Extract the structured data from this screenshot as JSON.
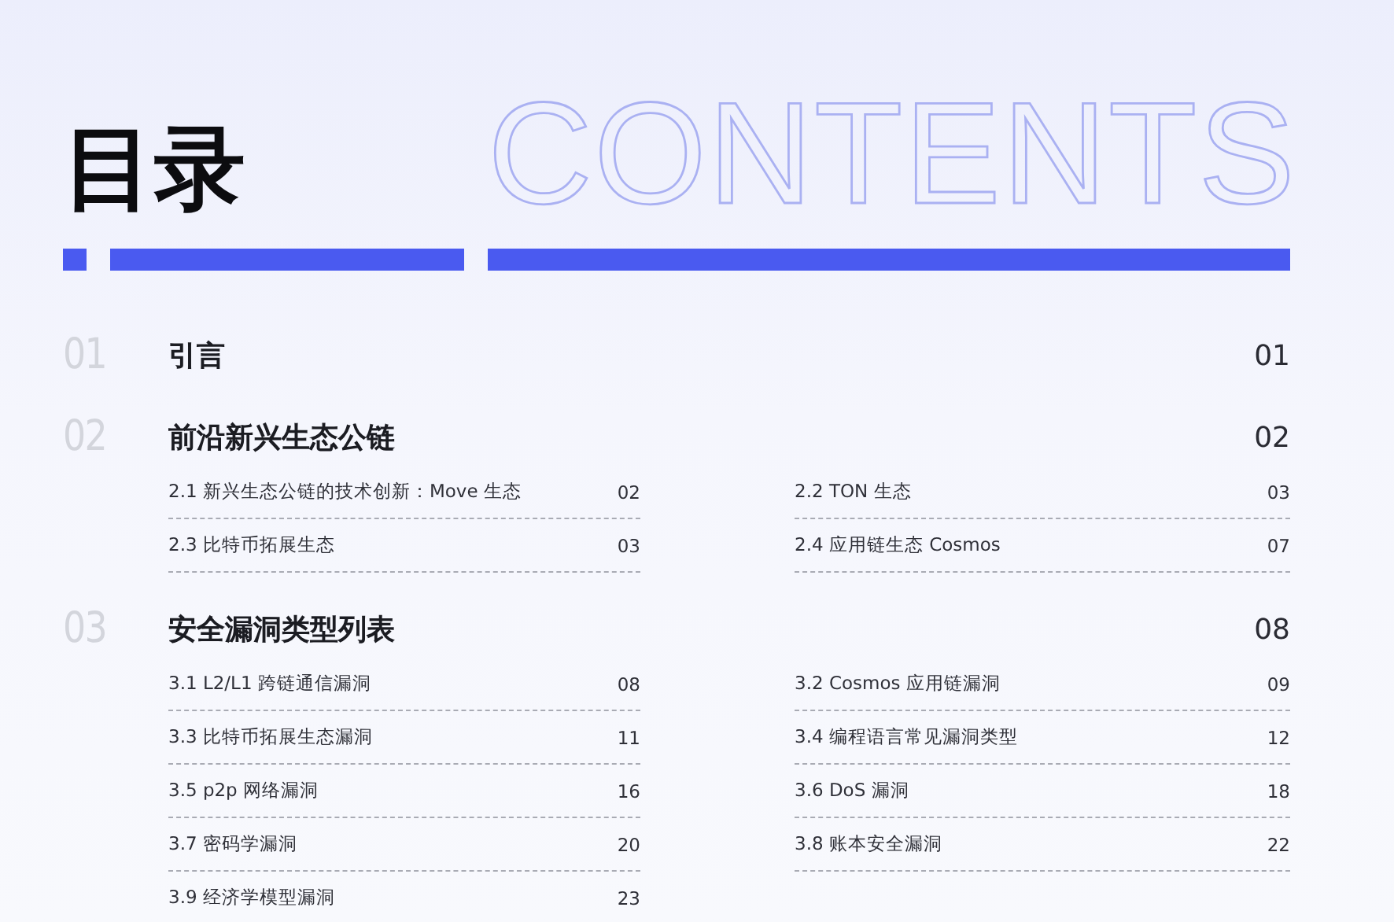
{
  "title": "目录",
  "title_en": "CONTENTS",
  "sections": [
    {
      "number": "01",
      "title": "引言",
      "page": "01"
    },
    {
      "number": "02",
      "title": "前沿新兴生态公链",
      "page": "02",
      "entries": [
        {
          "label": "2.1 新兴生态公链的技术创新：Move 生态",
          "page": "02"
        },
        {
          "label": "2.2 TON 生态",
          "page": "03"
        },
        {
          "label": "2.3 比特币拓展生态",
          "page": "03"
        },
        {
          "label": "2.4 应用链生态 Cosmos",
          "page": "07"
        }
      ]
    },
    {
      "number": "03",
      "title": "安全漏洞类型列表",
      "page": "08",
      "entries": [
        {
          "label": "3.1 L2/L1 跨链通信漏洞",
          "page": "08"
        },
        {
          "label": "3.2 Cosmos 应用链漏洞",
          "page": "09"
        },
        {
          "label": "3.3 比特币拓展生态漏洞",
          "page": "11"
        },
        {
          "label": "3.4 编程语言常见漏洞类型",
          "page": "12"
        },
        {
          "label": "3.5 p2p 网络漏洞",
          "page": "16"
        },
        {
          "label": "3.6 DoS 漏洞",
          "page": "18"
        },
        {
          "label": "3.7 密码学漏洞",
          "page": "20"
        },
        {
          "label": "3.8 账本安全漏洞",
          "page": "22"
        },
        {
          "label": "3.9 经济学模型漏洞",
          "page": "23"
        }
      ]
    }
  ]
}
